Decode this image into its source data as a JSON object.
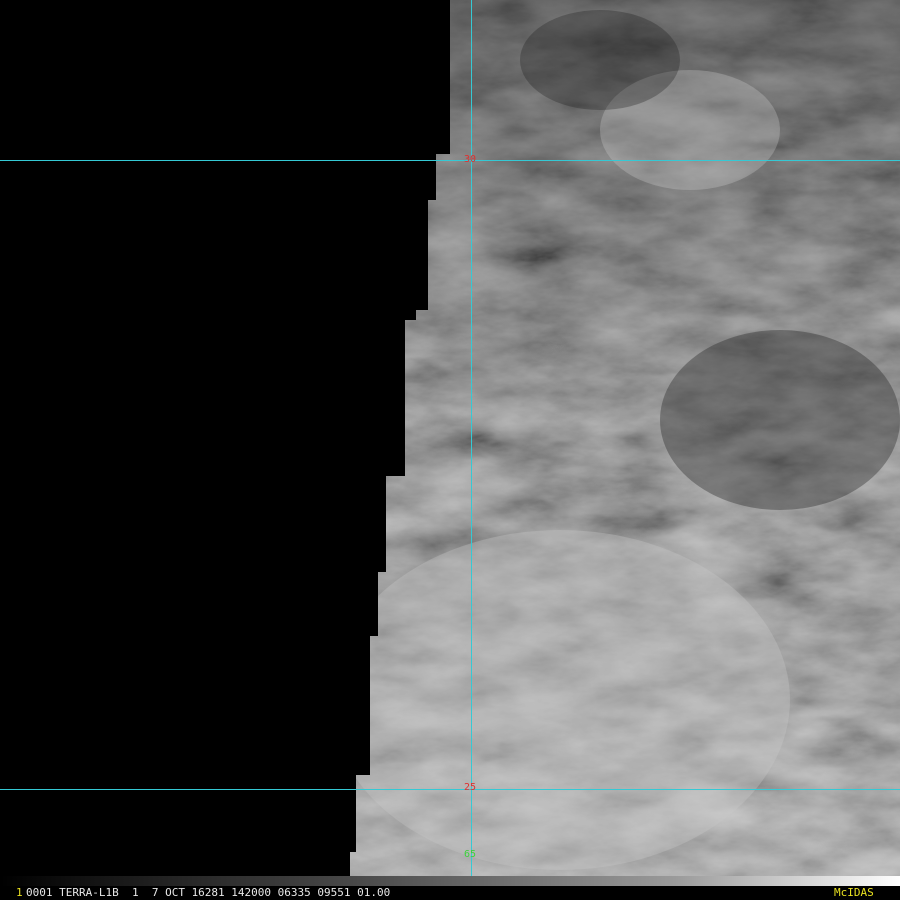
{
  "image": {
    "description_colors": {
      "gridline": "#35c9d4",
      "lat_label": "#e03030",
      "lon_label": "#3ad23a"
    }
  },
  "gridlines": {
    "lat_labels": [
      "30",
      "25"
    ],
    "lon_label": "65"
  },
  "status_bar": {
    "frame_number": "1",
    "text": "0001 TERRA-L1B  1  7 OCT 16281 142000 06335 09551 01.00",
    "brand": "McIDAS",
    "accent_color": "#e8e020"
  }
}
